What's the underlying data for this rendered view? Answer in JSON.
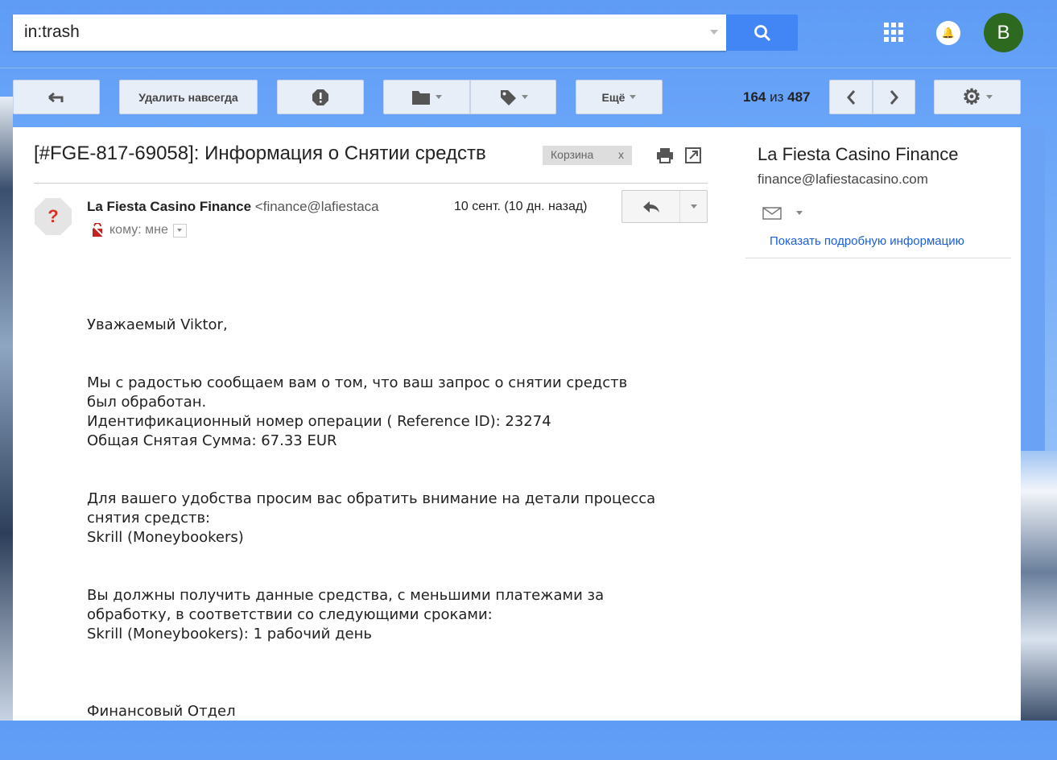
{
  "search": {
    "value": "in:trash"
  },
  "header": {
    "avatar_letter": "B"
  },
  "toolbar": {
    "delete_forever": "Удалить навсегда",
    "more": "Ещё",
    "count_current": "164",
    "count_sep": "из",
    "count_total": "487"
  },
  "message": {
    "subject": "[#FGE-817-69058]: Информация о Снятии средств",
    "label": "Корзина",
    "label_remove": "x",
    "sender_name": "La Fiesta Casino Finance",
    "sender_email": "<finance@lafiestaca",
    "date": "10 сент. (10 дн. назад)",
    "to": "кому: мне",
    "body": [
      [
        "Уважаемый Viktor,"
      ],
      [
        "Мы с радостью сообщаем вам о том, что ваш запрос о снятии средств",
        "был обработан.",
        "Идентификационный номер операции ( Reference ID): 23274",
        "Общая Снятая Сумма: 67.33 EUR"
      ],
      [
        "Для вашего удобства просим вас обратить внимание на детали процесса",
        "снятия средств:",
        "Skrill (Moneybookers)"
      ],
      [
        "Вы должны получить данные средства, с меньшими платежами за",
        "обработку, в соответствии со следующими сроками:",
        "Skrill (Moneybookers): 1 рабочий день"
      ],
      [
        "Финансовый Отдел"
      ]
    ]
  },
  "contact": {
    "name": "La Fiesta Casino Finance",
    "email": "finance@lafiestacasino.com",
    "details_link": "Показать подробную информацию"
  }
}
